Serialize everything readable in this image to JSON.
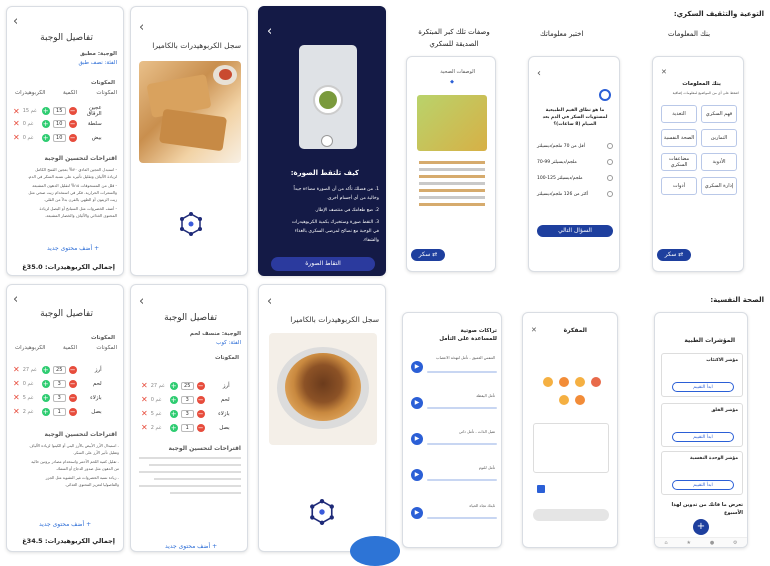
{
  "left_top": {
    "meal1": {
      "title": "تفاصيل الوجبة",
      "meal_label": "الوجبة: مطبق",
      "category": "الفئة: نصف طبق",
      "section": "المكونات",
      "columns": [
        "الكربوهيدرات",
        "الكمية",
        "المكونات"
      ],
      "items": [
        {
          "name": "عجين الرقاق",
          "grams": "15 غم",
          "qty": "15"
        },
        {
          "name": "سلطة",
          "grams": "0 غم",
          "qty": "10"
        },
        {
          "name": "بيض",
          "grams": "0 غم",
          "qty": "10"
        }
      ],
      "suggestions_title": "اقتراحات لتحسين الوجبة",
      "suggestions": [
        "- استبدل العجين العادي ٧٠% بعجين القمح الكامل",
        "لزيادة الألياف وتقليل تأثيره على نسبة السكر في الدم.",
        "- قلل من المسحوقات ١٥% لتقليل الدهون المشبعة",
        "والسعرات الحرارية. فكر في استخدام زيت صحي مثل",
        "زيت الزيتون أو الطهي بالفرن بدلاً من القلي.",
        "- أضف الخضروات مثل السبانخ أو البصل لزيادة",
        "المحتوى الغذائي والألياف والخضار المشبعة."
      ],
      "add_label": "+ أضف محتوى جديد",
      "total": "إجمالي الكربوهيدرات: 35.0غ"
    },
    "camera1": {
      "title": "سجل الكربوهيدرات بالكاميرا"
    },
    "howto": {
      "title": "كيف تلتقط الصورة:",
      "steps": [
        "1. من فضلك تأكد من أن الصورة مضاءة جيداً",
        "وخالية من أي أجسام أخرى.",
        "2. ضع طعامك في منتصف الإطار.",
        "3. التقط صورة وستخبرك بكمية الكربوهيدرات",
        "في الوجبة مع نصائح لمرضى السكري بالغذاء",
        "والشفاء."
      ],
      "button": "التقاط الصورة"
    }
  },
  "left_bottom": {
    "meal2": {
      "title": "تفاصيل الوجبة",
      "section": "المكونات",
      "columns": [
        "الكربوهيدرات",
        "الكمية",
        "المكونات"
      ],
      "items": [
        {
          "name": "أرز",
          "grams": "27 غم",
          "qty": "25"
        },
        {
          "name": "لحم",
          "grams": "0 غم",
          "qty": "3"
        },
        {
          "name": "بازلاء",
          "grams": "5 غم",
          "qty": "3"
        },
        {
          "name": "بصل",
          "grams": "2 غم",
          "qty": "1"
        }
      ],
      "suggestions_title": "اقتراحات لتحسين الوجبة",
      "suggestions": [
        "- استبدال الأرز الأبيض بالأرز البني أو الكينوا لزيادة الألياف",
        "وتقليل تأثير الأرز على السكر.",
        "- تقليل كمية اللحم الأحمر واستخدام مصادر بروتين خالية",
        "من الدهون مثل صدور الدجاج أو السمك.",
        "- زيادة نسبة الخضروات غير النشوية مثل الجزر",
        "والفاصوليا لتعزيز المحتوى الغذائي."
      ],
      "add_label": "+ أضف محتوى جديد",
      "total": "إجمالي الكربوهيدرات: 34.5غ"
    },
    "meal3": {
      "title": "تفاصيل الوجبة",
      "meal_label": "الوجبة: منسف لحم",
      "category": "الفئة: كوب",
      "section": "المكونات",
      "items": [
        {
          "name": "أرز",
          "grams": "27 غم",
          "qty": "25"
        },
        {
          "name": "لحم",
          "grams": "0 غم",
          "qty": "3"
        },
        {
          "name": "بازلاء",
          "grams": "5 غم",
          "qty": "3"
        },
        {
          "name": "بصل",
          "grams": "2 غم",
          "qty": "1"
        }
      ],
      "suggestions_title": "اقتراحات لتحسين الوجبة",
      "add_label": "+ أضف محتوى جديد"
    },
    "camera2": {
      "title": "سجل الكربوهيدرات بالكاميرا"
    }
  },
  "right": {
    "section1_title": "التوعية والتثقيف السكري:",
    "col_labels": [
      "بنك المعلومات",
      "اختبر معلوماتك",
      "وصفات تلك كبر المبتكرة الصديقة للسكري"
    ],
    "info_bank": {
      "title": "بنك المعلومات",
      "subtitle": "اضغط على أي من المواضيع لمعلومات إضافية",
      "cards": [
        "فهم السكري",
        "التغذية",
        "التمارين",
        "الصحة النفسية",
        "الأدوية",
        "مضاعفات السكري",
        "إدارة السكري",
        "أدوات"
      ],
      "button": "سكر"
    },
    "quiz": {
      "question": "ما هو نطاق القيم الطبيعية لمستويات السكر في الدم بعد الصيام (8 ساعات)؟",
      "options": [
        "أقل من 70 ملجم/ديسيلتر",
        "70-99 ملجم/ديسيلتر",
        "100-125 ملجم/ديسيلتر",
        "أكثر من 126 ملجم/ديسيلتر"
      ],
      "button": "السؤال التالي"
    },
    "recipe": {
      "title": "الوصفات الصحية",
      "button": "سكر"
    },
    "section2_title": "الصحة النفسية:",
    "audio": {
      "title": "تراكات صوتية للمساعدة على التأمل",
      "tracks": [
        "التنفس العميق - تأمل لتهدئة الاعصاب",
        "تأمل اليقظة",
        "تقبل الذات - تأمل ذاتي",
        "تأمل للنوم",
        "ثابتك تجاه الحياة"
      ]
    },
    "journal": {
      "title": "المفكرة"
    },
    "indicators": {
      "title": "المؤشرات الطبية",
      "cards": [
        "مؤشر الاكتئاب",
        "مؤشر القلق",
        "مؤشر الوحدة النفسية"
      ],
      "btn": "ابدأ التقييم",
      "footer": "تعرض ما فاتك من تدوين لهذا الأسبوع"
    }
  },
  "colors": {
    "dark_navy": "#141a46",
    "accent_blue": "#1e3f9e",
    "red": "#e74c3c",
    "green": "#2ecc71"
  }
}
